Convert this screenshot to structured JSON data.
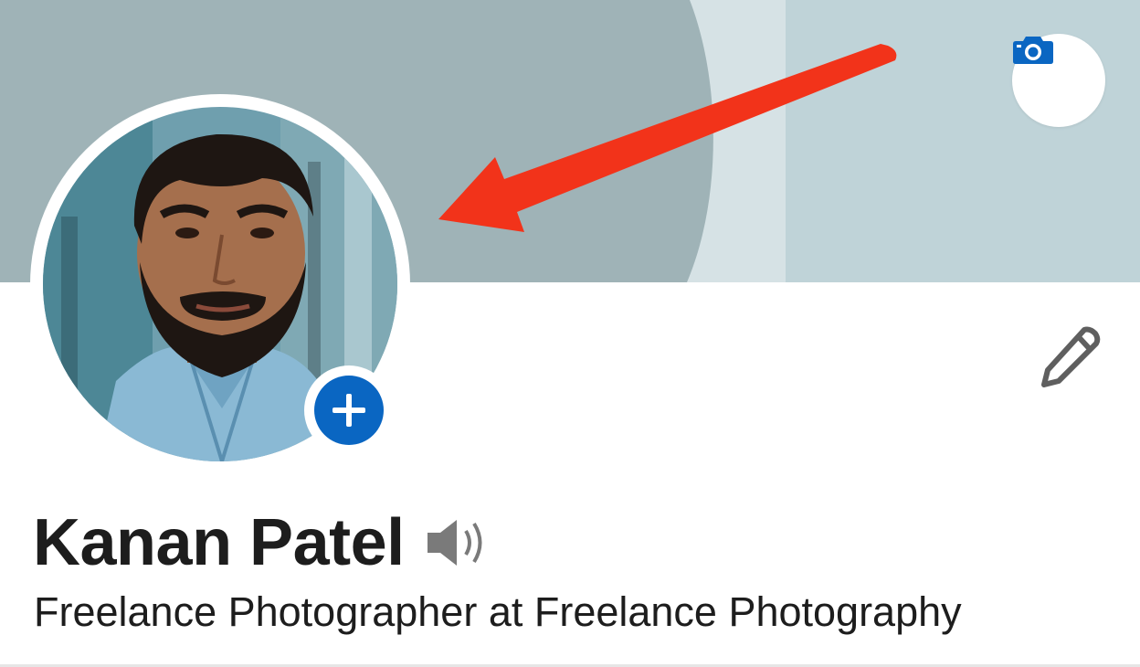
{
  "profile": {
    "name": "Kanan Patel",
    "headline": "Freelance Photographer at Freelance Photography"
  },
  "icons": {
    "cover_photo": "camera-icon",
    "add_photo": "plus-icon",
    "edit": "pencil-icon",
    "pronunciation": "speaker-icon",
    "annotation": "red-arrow"
  },
  "colors": {
    "accent": "#0a66c2",
    "annotation_arrow": "#f2331a",
    "banner_dark": "#9fb3b7",
    "banner_light": "#bfd3d8",
    "banner_stripe": "#d6e2e5",
    "text": "#1d1d1d"
  }
}
